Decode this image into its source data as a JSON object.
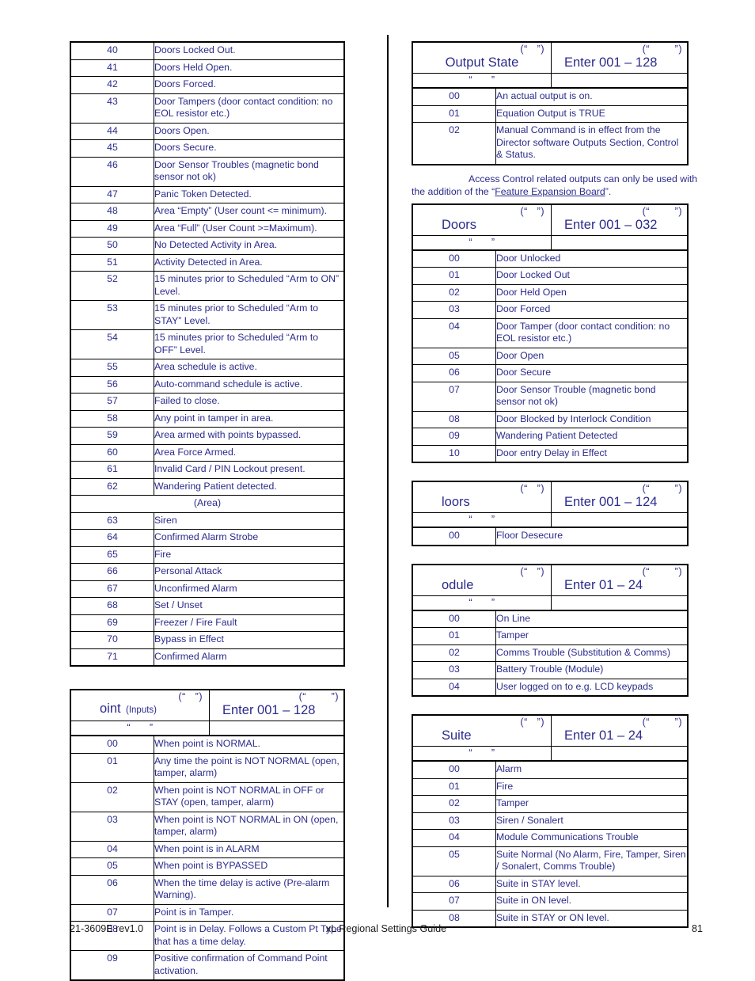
{
  "document": {
    "footer_left": "21-3609E rev1.0",
    "footer_center": "xL Regional Settings Guide",
    "footer_right": "81"
  },
  "quote_placeholder_short": "(“   ”)",
  "quote_placeholder_long": "(“        ”)",
  "quote_placeholder_sub": "“      ”",
  "left_column": {
    "event_table": {
      "rows": [
        {
          "code": "40",
          "desc": "Doors Locked Out."
        },
        {
          "code": "41",
          "desc": "Doors Held Open."
        },
        {
          "code": "42",
          "desc": "Doors Forced."
        },
        {
          "code": "43",
          "desc": "Door Tampers (door contact condition: no EOL resistor etc.)"
        },
        {
          "code": "44",
          "desc": "Doors Open."
        },
        {
          "code": "45",
          "desc": "Doors Secure."
        },
        {
          "code": "46",
          "desc": "Door Sensor Troubles (magnetic bond sensor not ok)"
        },
        {
          "code": "47",
          "desc": "Panic Token Detected."
        },
        {
          "code": "48",
          "desc": "Area “Empty” (User count <= minimum)."
        },
        {
          "code": "49",
          "desc": "Area “Full” (User Count >=Maximum)."
        },
        {
          "code": "50",
          "desc": "No Detected Activity in Area."
        },
        {
          "code": "51",
          "desc": "Activity Detected in Area."
        },
        {
          "code": "52",
          "desc": "15 minutes prior to Scheduled “Arm to ON” Level."
        },
        {
          "code": "53",
          "desc": "15 minutes prior to Scheduled “Arm to STAY” Level."
        },
        {
          "code": "54",
          "desc": "15 minutes prior to Scheduled “Arm to OFF” Level."
        },
        {
          "code": "55",
          "desc": "Area schedule is active."
        },
        {
          "code": "56",
          "desc": "Auto-command schedule is active."
        },
        {
          "code": "57",
          "desc": "Failed to close."
        },
        {
          "code": "58",
          "desc": "Any point in tamper in area."
        },
        {
          "code": "59",
          "desc": "Area armed with points bypassed."
        },
        {
          "code": "60",
          "desc": "Area Force Armed."
        },
        {
          "code": "61",
          "desc": "Invalid Card / PIN Lockout present."
        },
        {
          "code": "62",
          "desc": "Wandering Patient detected."
        }
      ],
      "section_label": "(Area)",
      "rows_after": [
        {
          "code": "63",
          "desc": "Siren"
        },
        {
          "code": "64",
          "desc": "Confirmed Alarm Strobe"
        },
        {
          "code": "65",
          "desc": "Fire"
        },
        {
          "code": "66",
          "desc": "Personal Attack"
        },
        {
          "code": "67",
          "desc": "Unconfirmed Alarm"
        },
        {
          "code": "68",
          "desc": "Set / Unset"
        },
        {
          "code": "69",
          "desc": "Freezer / Fire Fault"
        },
        {
          "code": "70",
          "desc": "Bypass in Effect"
        },
        {
          "code": "71",
          "desc": "Confirmed Alarm"
        }
      ]
    },
    "point_table": {
      "title": "oint",
      "title_sub": "(Inputs)",
      "range_label": "Enter 001 – 128",
      "rows": [
        {
          "code": "00",
          "desc": "When point is NORMAL."
        },
        {
          "code": "01",
          "desc": "Any time the point is NOT NORMAL (open, tamper, alarm)"
        },
        {
          "code": "02",
          "desc": "When point is NOT NORMAL in OFF or STAY (open, tamper, alarm)"
        },
        {
          "code": "03",
          "desc": "When point is NOT NORMAL in ON (open, tamper, alarm)"
        },
        {
          "code": "04",
          "desc": "When point is in ALARM"
        },
        {
          "code": "05",
          "desc": "When point is BYPASSED"
        },
        {
          "code": "06",
          "desc": "When the time delay is active (Pre-alarm Warning)."
        },
        {
          "code": "07",
          "desc": "Point is in Tamper."
        },
        {
          "code": "08",
          "desc": "Point is in Delay. Follows a Custom Pt Type that has a time delay."
        },
        {
          "code": "09",
          "desc": "Positive confirmation of Command Point activation."
        }
      ]
    }
  },
  "right_column": {
    "output_state_table": {
      "title": "Output State",
      "range_label": "Enter 001 – 128",
      "rows": [
        {
          "code": "00",
          "desc": "An actual output is on."
        },
        {
          "code": "01",
          "desc": "Equation Output is TRUE"
        },
        {
          "code": "02",
          "desc": "Manual Command is in effect from the Director software Outputs Section, Control & Status."
        }
      ]
    },
    "note_paragraph": {
      "before": "Access Control related outputs can only be used with the addition of the “",
      "underlined": "Feature Expansion Board",
      "after": "”."
    },
    "doors_table": {
      "title": "Doors",
      "range_label": "Enter 001 – 032",
      "rows": [
        {
          "code": "00",
          "desc": "Door Unlocked"
        },
        {
          "code": "01",
          "desc": "Door Locked Out"
        },
        {
          "code": "02",
          "desc": "Door Held Open"
        },
        {
          "code": "03",
          "desc": "Door Forced"
        },
        {
          "code": "04",
          "desc": "Door Tamper (door contact condition: no EOL resistor etc.)"
        },
        {
          "code": "05",
          "desc": "Door Open"
        },
        {
          "code": "06",
          "desc": "Door Secure"
        },
        {
          "code": "07",
          "desc": "Door Sensor Trouble (magnetic bond sensor not ok)"
        },
        {
          "code": "08",
          "desc": "Door Blocked by Interlock Condition"
        },
        {
          "code": "09",
          "desc": "Wandering Patient Detected"
        },
        {
          "code": "10",
          "desc": "Door entry Delay in Effect"
        }
      ]
    },
    "floors_table": {
      "title": "loors",
      "range_label": "Enter 001 – 124",
      "rows": [
        {
          "code": "00",
          "desc": "Floor Desecure"
        }
      ]
    },
    "module_table": {
      "title": "odule",
      "range_label": "Enter 01 – 24",
      "rows": [
        {
          "code": "00",
          "desc": "On Line"
        },
        {
          "code": "01",
          "desc": "Tamper"
        },
        {
          "code": "02",
          "desc": "Comms Trouble (Substitution & Comms)"
        },
        {
          "code": "03",
          "desc": "Battery Trouble (Module)"
        },
        {
          "code": "04",
          "desc": "User logged on to e.g. LCD keypads"
        }
      ]
    },
    "suite_table": {
      "title": "Suite",
      "range_label": "Enter 01 – 24",
      "rows": [
        {
          "code": "00",
          "desc": "Alarm"
        },
        {
          "code": "01",
          "desc": "Fire"
        },
        {
          "code": "02",
          "desc": "Tamper"
        },
        {
          "code": "03",
          "desc": "Siren / Sonalert"
        },
        {
          "code": "04",
          "desc": "Module Communications Trouble"
        },
        {
          "code": "05",
          "desc": "Suite Normal (No Alarm, Fire, Tamper, Siren / Sonalert, Comms Trouble)"
        },
        {
          "code": "06",
          "desc": "Suite in STAY level."
        },
        {
          "code": "07",
          "desc": "Suite in ON level."
        },
        {
          "code": "08",
          "desc": "Suite in STAY or ON level."
        }
      ]
    }
  }
}
